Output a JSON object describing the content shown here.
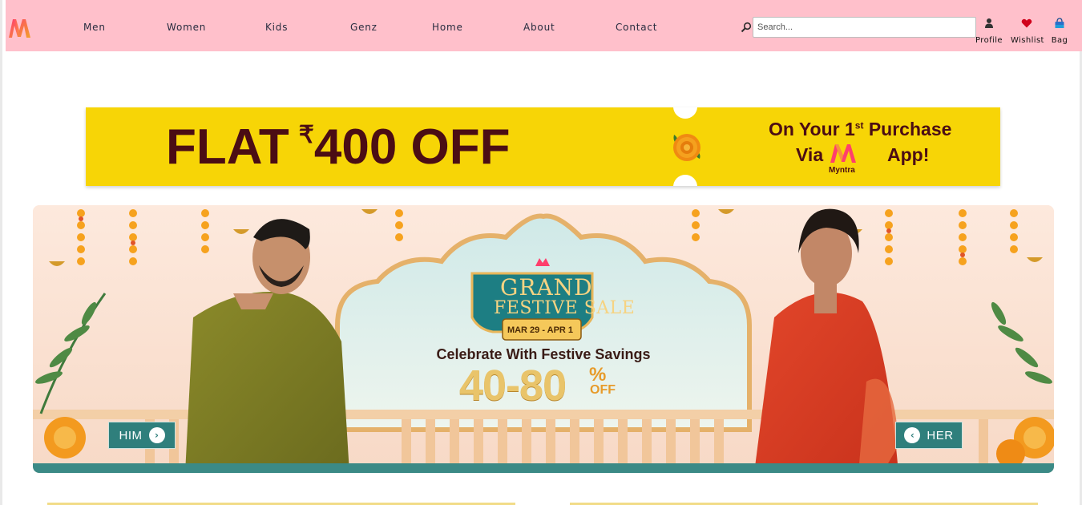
{
  "nav": {
    "links": [
      "Men",
      "Women",
      "Kids",
      "Genz",
      "Home",
      "About",
      "Contact"
    ],
    "search_placeholder": "Search...",
    "actions": [
      {
        "label": "Profile",
        "icon": "profile-icon"
      },
      {
        "label": "Wishlist",
        "icon": "heart-icon"
      },
      {
        "label": "Bag",
        "icon": "bag-icon"
      }
    ],
    "background_color": "#ffc0cb"
  },
  "promo": {
    "flat": "FLAT",
    "rupee": "₹",
    "amount": "400 OFF",
    "line1_pre": "On Your 1",
    "line1_sup": "st",
    "line1_post": " Purchase",
    "line2_pre": "Via",
    "line2_post": "App!",
    "brand": "Myntra",
    "background_color": "#f7d506"
  },
  "hero": {
    "title_line1": "GRAND",
    "title_line2": "FESTIVE SALE",
    "dates": "MAR 29 - APR 1",
    "tagline": "Celebrate With Festive Savings",
    "discount": "40-80",
    "percent": "%",
    "off": "OFF",
    "left_button": "HIM",
    "right_button": "HER"
  }
}
